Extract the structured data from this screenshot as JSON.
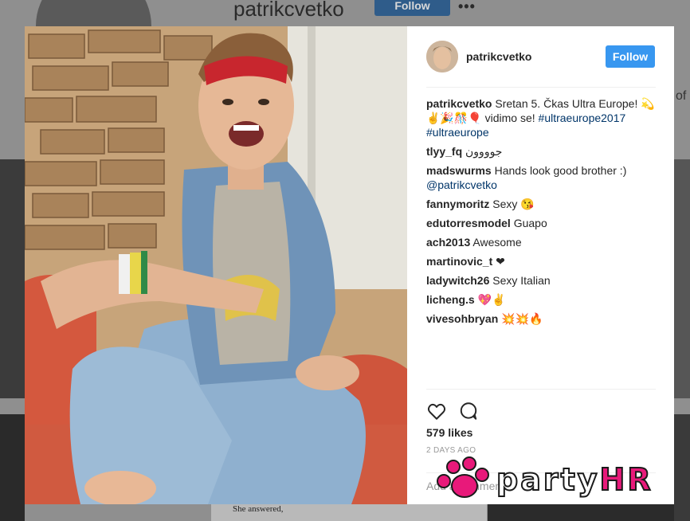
{
  "background": {
    "username": "patrikcvetko",
    "follow_label": "Follow",
    "more_label": "•••",
    "right_fragment": "of",
    "bottom_text": "She answered,"
  },
  "post": {
    "header": {
      "username": "patrikcvetko",
      "follow_label": "Follow"
    },
    "caption": {
      "username": "patrikcvetko",
      "text": "Sretan 5. Čkas Ultra Europe! 💫✌️🎉🎊🎈 vidimo se!",
      "hashtag1": "#ultraeurope2017",
      "hashtag2": "#ultraeurope"
    },
    "comments": [
      {
        "user": "tlyy_fq",
        "text": "جوووون"
      },
      {
        "user": "madswurms",
        "text": "Hands look good brother :)",
        "mention": "@patrikcvetko"
      },
      {
        "user": "fannymoritz",
        "text": "Sexy 😘"
      },
      {
        "user": "edutorresmodel",
        "text": "Guapo"
      },
      {
        "user": "ach2013",
        "text": "Awesome"
      },
      {
        "user": "martinovic_t",
        "text": "❤"
      },
      {
        "user": "ladywitch26",
        "text": "Sexy Italian"
      },
      {
        "user": "licheng.s",
        "text": "💖✌️"
      },
      {
        "user": "vivesohbryan",
        "text": "💥💥🔥"
      }
    ],
    "likes": "579 likes",
    "time": "2 DAYS AGO",
    "comment_placeholder": "Add a comment..."
  },
  "watermark": {
    "party": "party",
    "hr": "HR",
    "brand_color": "#e8197a"
  },
  "icons": {
    "like": "heart-icon",
    "comment": "comment-bubble-icon"
  },
  "colors": {
    "follow_button": "#3897f0",
    "hashtag": "#003569"
  }
}
